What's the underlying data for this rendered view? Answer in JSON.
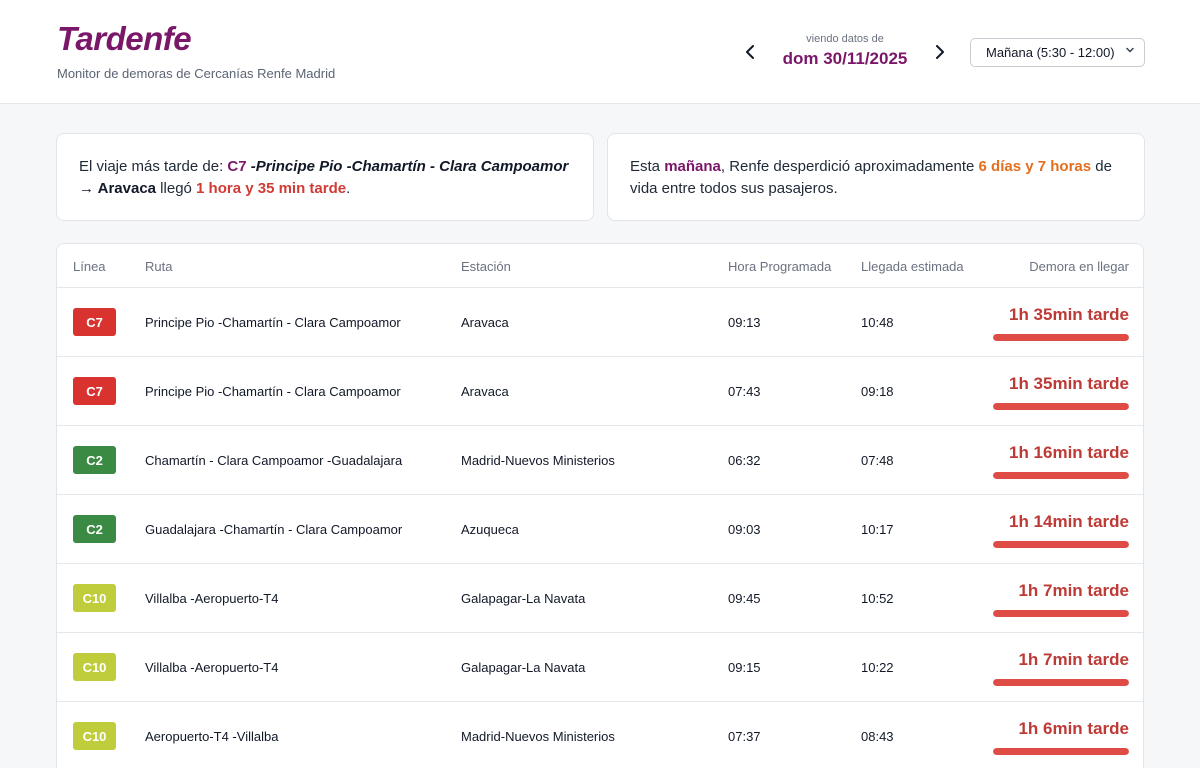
{
  "header": {
    "title": "Tardenfe",
    "subtitle": "Monitor de demoras de Cercanías Renfe Madrid",
    "date_caption": "viendo datos de",
    "date_value": "dom 30/11/2025",
    "period_selected": "Mañana (5:30 - 12:00)",
    "icons": {
      "prev": "chevron-left-icon",
      "next": "chevron-right-icon",
      "select": "chevron-down-icon"
    }
  },
  "summary_latest": {
    "prefix": "El viaje más tarde de: ",
    "line": "C7",
    "route": " -Principe Pio -Chamartín - Clara Campoamor",
    "arrow": " → ",
    "station": "Aravaca",
    "middle": " llegó ",
    "delay": "1 hora y 35 min tarde",
    "suffix": "."
  },
  "summary_wasted": {
    "prefix": "Esta ",
    "period": "mañana",
    "middle": ", Renfe desperdició aproximadamente ",
    "amount": "6 días y 7 horas",
    "suffix": " de vida entre todos sus pasajeros."
  },
  "table": {
    "headers": {
      "line": "Línea",
      "route": "Ruta",
      "station": "Estación",
      "scheduled": "Hora Programada",
      "estimated": "Llegada estimada",
      "delay": "Demora en llegar"
    },
    "rows": [
      {
        "line": "C7",
        "line_color": "#d8332f",
        "route": "Principe Pio -Chamartín - Clara Campoamor",
        "station": "Aravaca",
        "scheduled": "09:13",
        "estimated": "10:48",
        "delay": "1h 35min tarde",
        "delay_level": 1.0
      },
      {
        "line": "C7",
        "line_color": "#d8332f",
        "route": "Principe Pio -Chamartín - Clara Campoamor",
        "station": "Aravaca",
        "scheduled": "07:43",
        "estimated": "09:18",
        "delay": "1h 35min tarde",
        "delay_level": 1.0
      },
      {
        "line": "C2",
        "line_color": "#3a8a43",
        "route": "Chamartín - Clara Campoamor -Guadalajara",
        "station": "Madrid-Nuevos Ministerios",
        "scheduled": "06:32",
        "estimated": "07:48",
        "delay": "1h 16min tarde",
        "delay_level": 1.0
      },
      {
        "line": "C2",
        "line_color": "#3a8a43",
        "route": "Guadalajara -Chamartín - Clara Campoamor",
        "station": "Azuqueca",
        "scheduled": "09:03",
        "estimated": "10:17",
        "delay": "1h 14min tarde",
        "delay_level": 1.0
      },
      {
        "line": "C10",
        "line_color": "#bfcd3c",
        "route": "Villalba -Aeropuerto-T4",
        "station": "Galapagar-La Navata",
        "scheduled": "09:45",
        "estimated": "10:52",
        "delay": "1h 7min tarde",
        "delay_level": 1.0
      },
      {
        "line": "C10",
        "line_color": "#bfcd3c",
        "route": "Villalba -Aeropuerto-T4",
        "station": "Galapagar-La Navata",
        "scheduled": "09:15",
        "estimated": "10:22",
        "delay": "1h 7min tarde",
        "delay_level": 1.0
      },
      {
        "line": "C10",
        "line_color": "#bfcd3c",
        "route": "Aeropuerto-T4 -Villalba",
        "station": "Madrid-Nuevos Ministerios",
        "scheduled": "07:37",
        "estimated": "08:43",
        "delay": "1h 6min tarde",
        "delay_level": 1.0
      }
    ]
  }
}
